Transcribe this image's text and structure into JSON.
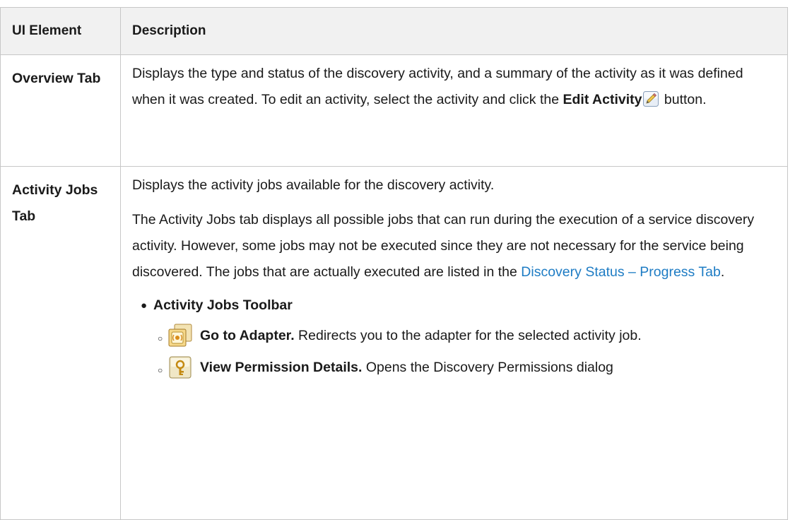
{
  "table": {
    "header": {
      "col1": "UI Element",
      "col2": "Description"
    },
    "rows": [
      {
        "term": "Overview Tab",
        "desc": {
          "part1": "Displays the type and status of the discovery activity, and a summary of the activity as it was defined when it was created. To edit an activity, select the activity and click the ",
          "bold": "Edit Activity",
          "part2": " button."
        },
        "icon": "pencil-edit-icon"
      },
      {
        "term": "Activity Jobs Tab",
        "para1": "Displays the activity jobs available for the discovery activity.",
        "para2": {
          "text": "The Activity Jobs tab displays all possible jobs that can run during the execution of a service discovery activity. However, some jobs may not be executed since they are not necessary for the service being discovered. The jobs that are actually executed are listed in the ",
          "link": "Discovery Status – Progress Tab",
          "end": "."
        },
        "toolbar": {
          "title": "Activity Jobs Toolbar",
          "items": [
            {
              "icon": "go-to-adapter-icon",
              "label": "Go to Adapter.",
              "text": " Redirects you to the adapter for the selected activity job."
            },
            {
              "icon": "view-permission-icon",
              "label": "View Permission Details.",
              "text": " Opens the Discovery Permissions dialog"
            }
          ]
        }
      }
    ]
  },
  "colors": {
    "link": "#1e7cc4",
    "header_bg": "#f1f1f1",
    "border": "#c7c7c7"
  }
}
